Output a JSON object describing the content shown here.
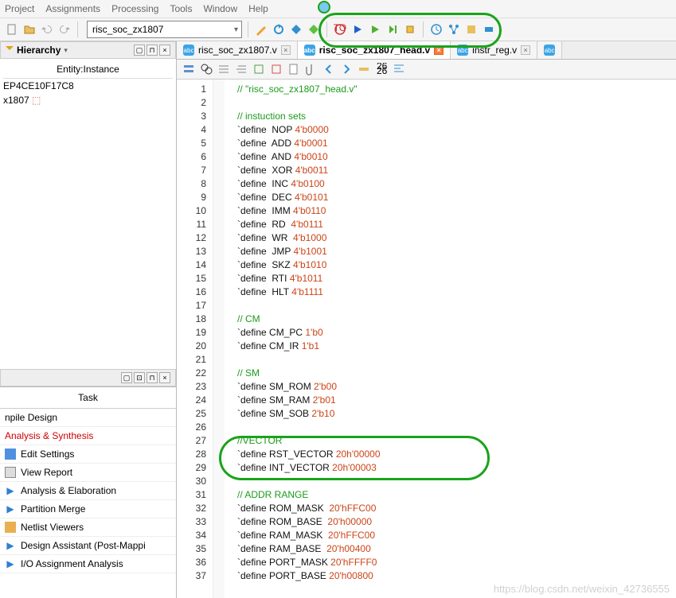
{
  "menu": {
    "project": "Project",
    "assignments": "Assignments",
    "processing": "Processing",
    "tools": "Tools",
    "window": "Window",
    "help": "Help"
  },
  "project_name": "risc_soc_zx1807",
  "left": {
    "hierarchy_label": "Hierarchy",
    "entity_header": "Entity:Instance",
    "device": "EP4CE10F17C8",
    "top": "x1807",
    "pane2_btns": "▢ 🖵 ⊓ ×",
    "task_label": "Task"
  },
  "tasks": [
    {
      "label": "npile Design",
      "kind": "plain"
    },
    {
      "label": "Analysis & Synthesis",
      "kind": "red"
    },
    {
      "label": "Edit Settings",
      "kind": "item",
      "icon": "doc"
    },
    {
      "label": "View Report",
      "kind": "item",
      "icon": "report"
    },
    {
      "label": "Analysis & Elaboration",
      "kind": "item",
      "icon": "play"
    },
    {
      "label": "Partition Merge",
      "kind": "item",
      "icon": "play"
    },
    {
      "label": "Netlist Viewers",
      "kind": "group",
      "icon": "folder"
    },
    {
      "label": "Design Assistant (Post-Mappi",
      "kind": "item",
      "icon": "play"
    },
    {
      "label": "I/O Assignment Analysis",
      "kind": "item",
      "icon": "play"
    }
  ],
  "tabs": [
    {
      "file": "risc_soc_zx1807.v",
      "active": false,
      "modified": false
    },
    {
      "file": "risc_soc_zx1807_head.v",
      "active": true,
      "modified": true
    },
    {
      "file": "instr_reg.v",
      "active": false,
      "modified": false
    }
  ],
  "code": [
    {
      "n": 1,
      "t": "   // \"risc_soc_zx1807_head.v\"",
      "c": "cmt"
    },
    {
      "n": 2,
      "t": "",
      "c": ""
    },
    {
      "n": 3,
      "t": "   // instuction sets",
      "c": "cmt"
    },
    {
      "n": 4,
      "t": "   `define  NOP ",
      "c": "kw",
      "v": "4'b0000"
    },
    {
      "n": 5,
      "t": "   `define  ADD ",
      "c": "kw",
      "v": "4'b0001"
    },
    {
      "n": 6,
      "t": "   `define  AND ",
      "c": "kw",
      "v": "4'b0010"
    },
    {
      "n": 7,
      "t": "   `define  XOR ",
      "c": "kw",
      "v": "4'b0011"
    },
    {
      "n": 8,
      "t": "   `define  INC ",
      "c": "kw",
      "v": "4'b0100"
    },
    {
      "n": 9,
      "t": "   `define  DEC ",
      "c": "kw",
      "v": "4'b0101"
    },
    {
      "n": 10,
      "t": "   `define  IMM ",
      "c": "kw",
      "v": "4'b0110"
    },
    {
      "n": 11,
      "t": "   `define  RD  ",
      "c": "kw",
      "v": "4'b0111"
    },
    {
      "n": 12,
      "t": "   `define  WR  ",
      "c": "kw",
      "v": "4'b1000"
    },
    {
      "n": 13,
      "t": "   `define  JMP ",
      "c": "kw",
      "v": "4'b1001"
    },
    {
      "n": 14,
      "t": "   `define  SKZ ",
      "c": "kw",
      "v": "4'b1010"
    },
    {
      "n": 15,
      "t": "   `define  RTI ",
      "c": "kw",
      "v": "4'b1011"
    },
    {
      "n": 16,
      "t": "   `define  HLT ",
      "c": "kw",
      "v": "4'b1111"
    },
    {
      "n": 17,
      "t": "",
      "c": ""
    },
    {
      "n": 18,
      "t": "   // CM",
      "c": "cmt"
    },
    {
      "n": 19,
      "t": "   `define CM_PC ",
      "c": "kw",
      "v": "1'b0"
    },
    {
      "n": 20,
      "t": "   `define CM_IR ",
      "c": "kw",
      "v": "1'b1"
    },
    {
      "n": 21,
      "t": "",
      "c": ""
    },
    {
      "n": 22,
      "t": "   // SM",
      "c": "cmt"
    },
    {
      "n": 23,
      "t": "   `define SM_ROM ",
      "c": "kw",
      "v": "2'b00"
    },
    {
      "n": 24,
      "t": "   `define SM_RAM ",
      "c": "kw",
      "v": "2'b01"
    },
    {
      "n": 25,
      "t": "   `define SM_SOB ",
      "c": "kw",
      "v": "2'b10"
    },
    {
      "n": 26,
      "t": "",
      "c": ""
    },
    {
      "n": 27,
      "t": "   //VECTOR",
      "c": "cmt"
    },
    {
      "n": 28,
      "t": "   `define RST_VECTOR ",
      "c": "kw",
      "v": "20h'00000"
    },
    {
      "n": 29,
      "t": "   `define INT_VECTOR ",
      "c": "kw",
      "v": "20h'00003"
    },
    {
      "n": 30,
      "t": "",
      "c": ""
    },
    {
      "n": 31,
      "t": "   // ADDR RANGE",
      "c": "cmt"
    },
    {
      "n": 32,
      "t": "   `define ROM_MASK  ",
      "c": "kw",
      "v": "20'hFFC00"
    },
    {
      "n": 33,
      "t": "   `define ROM_BASE  ",
      "c": "kw",
      "v": "20'h00000"
    },
    {
      "n": 34,
      "t": "   `define RAM_MASK  ",
      "c": "kw",
      "v": "20'hFFC00"
    },
    {
      "n": 35,
      "t": "   `define RAM_BASE  ",
      "c": "kw",
      "v": "20'h00400"
    },
    {
      "n": 36,
      "t": "   `define PORT_MASK ",
      "c": "kw",
      "v": "20'hFFFF0"
    },
    {
      "n": 37,
      "t": "   `define PORT_BASE ",
      "c": "kw",
      "v": "20'h00800"
    }
  ],
  "watermark": "https://blog.csdn.net/weixin_42736555"
}
